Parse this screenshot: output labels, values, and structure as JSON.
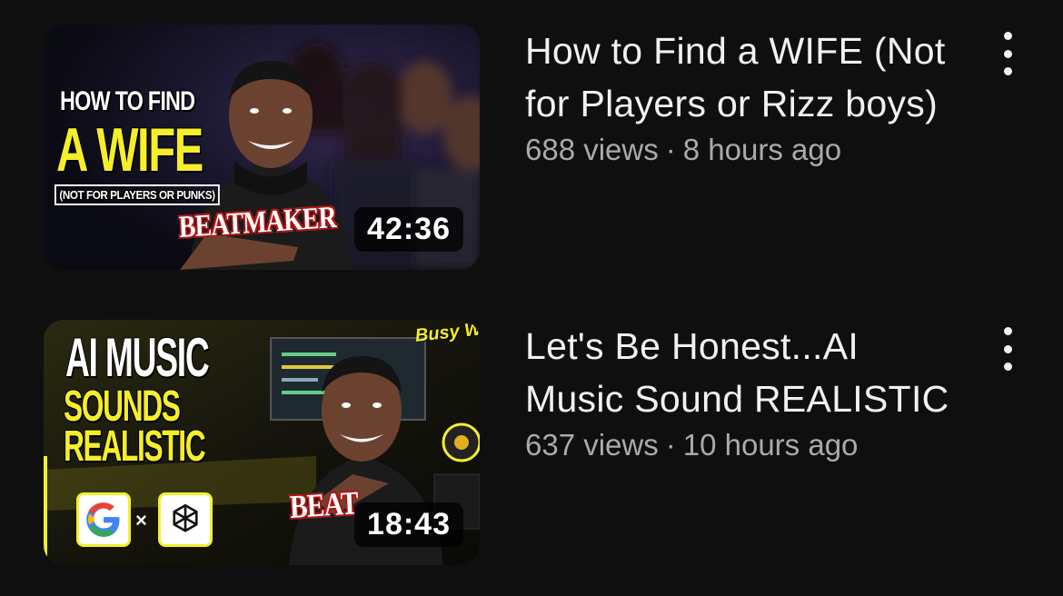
{
  "videos": [
    {
      "title": "How to Find a WIFE (Not for Players or Rizz boys)",
      "views": "688 views",
      "age": "8 hours ago",
      "duration": "42:36",
      "thumbnail": {
        "line1": "HOW TO FIND",
        "line2": "A WIFE",
        "line3": "(NOT FOR PLAYERS OR PUNKS)",
        "brand": "BEATMAKER"
      }
    },
    {
      "title": "Let's Be Honest...AI Music Sound REALISTIC",
      "views": "637 views",
      "age": "10 hours ago",
      "duration": "18:43",
      "thumbnail": {
        "line1": "AI MUSIC",
        "line2": "SOUNDS",
        "line3": "REALISTIC",
        "tag": "Busy Works Beats",
        "brand": "BEAT",
        "times": "×"
      }
    }
  ],
  "separator": "·",
  "icons": {
    "more": "more-vert-icon",
    "google": "google-logo-icon",
    "openai": "openai-logo-icon"
  },
  "colors": {
    "background": "#0f0f0f",
    "title": "#f1f1f1",
    "meta": "#aaaaaa",
    "accent_yellow": "#f5ee2a",
    "brand_red": "#b01515"
  }
}
